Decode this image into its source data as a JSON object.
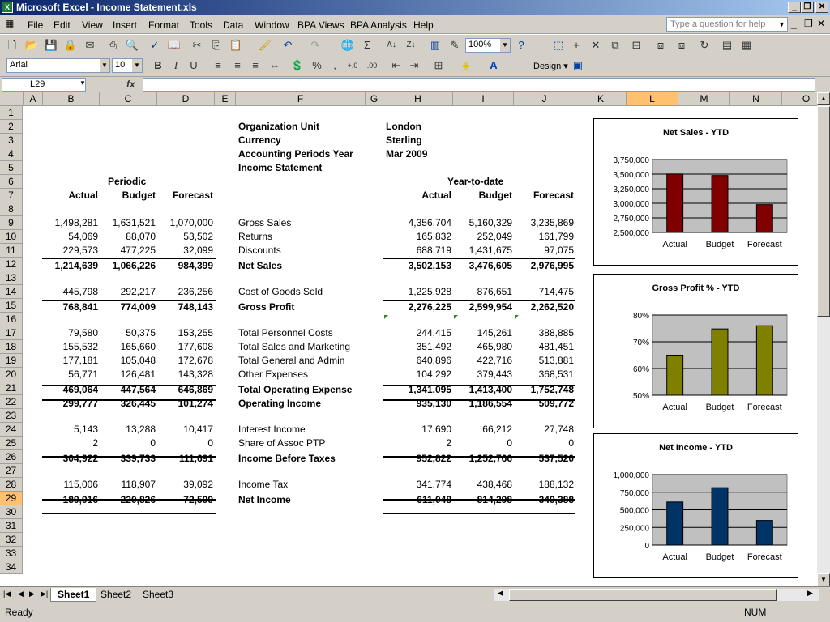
{
  "window": {
    "title": "Microsoft Excel - Income Statement.xls"
  },
  "menu": [
    "File",
    "Edit",
    "View",
    "Insert",
    "Format",
    "Tools",
    "Data",
    "Window",
    "BPA Views",
    "BPA Analysis",
    "Help"
  ],
  "help_placeholder": "Type a question for help",
  "toolbar": {
    "zoom": "100%",
    "font": "Arial",
    "font_size": "10",
    "design_label": "Design ▾"
  },
  "formula_bar": {
    "name_box": "L29",
    "fx": "fx",
    "value": ""
  },
  "columns": [
    "A",
    "B",
    "C",
    "D",
    "E",
    "F",
    "G",
    "H",
    "I",
    "J",
    "K",
    "L",
    "M",
    "N",
    "O"
  ],
  "rows": [
    "1",
    "2",
    "3",
    "4",
    "5",
    "6",
    "7",
    "8",
    "9",
    "10",
    "11",
    "12",
    "13",
    "14",
    "15",
    "16",
    "17",
    "18",
    "19",
    "20",
    "21",
    "22",
    "23",
    "24",
    "25",
    "26",
    "27",
    "28",
    "29",
    "30",
    "31",
    "32",
    "33",
    "34"
  ],
  "selection": {
    "column": "L",
    "row": "29"
  },
  "header_info": {
    "labels": [
      "Organization Unit",
      "Currency",
      "Accounting Periods Year",
      "Income Statement"
    ],
    "values": [
      "London",
      "Sterling",
      "Mar 2009",
      ""
    ]
  },
  "headers": {
    "periodic": "Periodic",
    "ytd": "Year-to-date",
    "actual": "Actual",
    "budget": "Budget",
    "forecast": "Forecast"
  },
  "statement": [
    {
      "row": 9,
      "label": "Gross Sales",
      "periodic": [
        "1,498,281",
        "1,631,521",
        "1,070,000"
      ],
      "ytd": [
        "4,356,704",
        "5,160,329",
        "3,235,869"
      ],
      "bold": false
    },
    {
      "row": 10,
      "label": "Returns",
      "periodic": [
        "54,069",
        "88,070",
        "53,502"
      ],
      "ytd": [
        "165,832",
        "252,049",
        "161,799"
      ],
      "bold": false
    },
    {
      "row": 11,
      "label": "Discounts",
      "periodic": [
        "229,573",
        "477,225",
        "32,099"
      ],
      "ytd": [
        "688,719",
        "1,431,675",
        "97,075"
      ],
      "bold": false
    },
    {
      "row": 12,
      "label": "Net Sales",
      "periodic": [
        "1,214,639",
        "1,066,226",
        "984,399"
      ],
      "ytd": [
        "3,502,153",
        "3,476,605",
        "2,976,995"
      ],
      "bold": true
    },
    {
      "row": 14,
      "label": "Cost of Goods Sold",
      "periodic": [
        "445,798",
        "292,217",
        "236,256"
      ],
      "ytd": [
        "1,225,928",
        "876,651",
        "714,475"
      ],
      "bold": false
    },
    {
      "row": 15,
      "label": "Gross Profit",
      "periodic": [
        "768,841",
        "774,009",
        "748,143"
      ],
      "ytd": [
        "2,276,225",
        "2,599,954",
        "2,262,520"
      ],
      "bold": true
    },
    {
      "row": 17,
      "label": "Total Personnel Costs",
      "periodic": [
        "79,580",
        "50,375",
        "153,255"
      ],
      "ytd": [
        "244,415",
        "145,261",
        "388,885"
      ],
      "bold": false
    },
    {
      "row": 18,
      "label": "Total Sales and Marketing",
      "periodic": [
        "155,532",
        "165,660",
        "177,608"
      ],
      "ytd": [
        "351,492",
        "465,980",
        "481,451"
      ],
      "bold": false
    },
    {
      "row": 19,
      "label": "Total General and Admin",
      "periodic": [
        "177,181",
        "105,048",
        "172,678"
      ],
      "ytd": [
        "640,896",
        "422,716",
        "513,881"
      ],
      "bold": false
    },
    {
      "row": 20,
      "label": "Other Expenses",
      "periodic": [
        "56,771",
        "126,481",
        "143,328"
      ],
      "ytd": [
        "104,292",
        "379,443",
        "368,531"
      ],
      "bold": false
    },
    {
      "row": 21,
      "label": "Total Operating Expense",
      "periodic": [
        "469,064",
        "447,564",
        "646,869"
      ],
      "ytd": [
        "1,341,095",
        "1,413,400",
        "1,752,748"
      ],
      "bold": true
    },
    {
      "row": 22,
      "label": "Operating Income",
      "periodic": [
        "299,777",
        "326,445",
        "101,274"
      ],
      "ytd": [
        "935,130",
        "1,186,554",
        "509,772"
      ],
      "bold": true
    },
    {
      "row": 24,
      "label": "Interest Income",
      "periodic": [
        "5,143",
        "13,288",
        "10,417"
      ],
      "ytd": [
        "17,690",
        "66,212",
        "27,748"
      ],
      "bold": false
    },
    {
      "row": 25,
      "label": "Share of Assoc PTP",
      "periodic": [
        "2",
        "0",
        "0"
      ],
      "ytd": [
        "2",
        "0",
        "0"
      ],
      "bold": false
    },
    {
      "row": 26,
      "label": "Income Before Taxes",
      "periodic": [
        "304,922",
        "339,733",
        "111,691"
      ],
      "ytd": [
        "952,822",
        "1,252,766",
        "537,520"
      ],
      "bold": true
    },
    {
      "row": 28,
      "label": "Income Tax",
      "periodic": [
        "115,006",
        "118,907",
        "39,092"
      ],
      "ytd": [
        "341,774",
        "438,468",
        "188,132"
      ],
      "bold": false
    },
    {
      "row": 29,
      "label": "Net Income",
      "periodic": [
        "189,916",
        "220,826",
        "72,599"
      ],
      "ytd": [
        "611,048",
        "814,298",
        "349,388"
      ],
      "bold": true
    }
  ],
  "chart_data": [
    {
      "type": "bar",
      "title": "Net Sales - YTD",
      "categories": [
        "Actual",
        "Budget",
        "Forecast"
      ],
      "values": [
        3502153,
        3476605,
        2976995
      ],
      "ylim": [
        2500000,
        3750000
      ],
      "ticks": [
        "3,750,000",
        "3,500,000",
        "3,250,000",
        "3,000,000",
        "2,750,000",
        "2,500,000"
      ],
      "color": "#800000",
      "grid": true
    },
    {
      "type": "bar",
      "title": "Gross Profit % - YTD",
      "categories": [
        "Actual",
        "Budget",
        "Forecast"
      ],
      "values": [
        65.0,
        74.8,
        76.0
      ],
      "ylim": [
        50,
        80
      ],
      "ticks": [
        "80%",
        "70%",
        "60%",
        "50%"
      ],
      "color": "#808000",
      "grid": true
    },
    {
      "type": "bar",
      "title": "Net Income - YTD",
      "categories": [
        "Actual",
        "Budget",
        "Forecast"
      ],
      "values": [
        611048,
        814298,
        349388
      ],
      "ylim": [
        0,
        1000000
      ],
      "ticks": [
        "1,000,000",
        "750,000",
        "500,000",
        "250,000",
        "0"
      ],
      "color": "#003366",
      "grid": true
    }
  ],
  "sheets": [
    "Sheet1",
    "Sheet2",
    "Sheet3"
  ],
  "active_sheet": "Sheet1",
  "status": {
    "left": "Ready",
    "num": "NUM"
  }
}
